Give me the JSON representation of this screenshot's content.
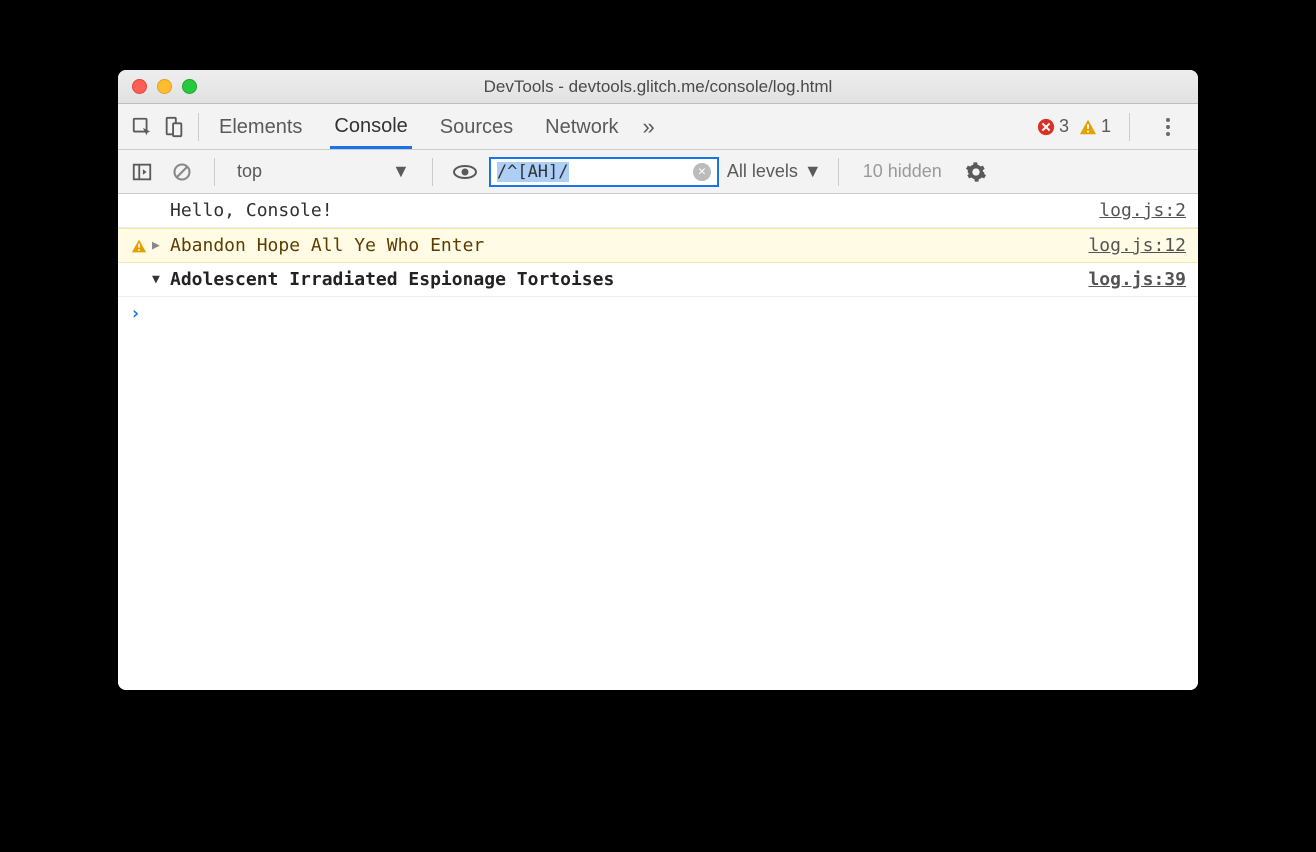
{
  "window": {
    "title": "DevTools - devtools.glitch.me/console/log.html"
  },
  "tabs": {
    "items": [
      "Elements",
      "Console",
      "Sources",
      "Network"
    ],
    "errors": "3",
    "warnings": "1"
  },
  "toolbar": {
    "context": "top",
    "filter_value": "/^[AH]/",
    "levels_label": "All levels",
    "hidden_label": "10 hidden"
  },
  "messages": [
    {
      "type": "log",
      "text": "Hello, Console!",
      "src": "log.js:2"
    },
    {
      "type": "warn",
      "text": "Abandon Hope All Ye Who Enter",
      "src": "log.js:12"
    },
    {
      "type": "group",
      "text": "Adolescent Irradiated Espionage Tortoises",
      "src": "log.js:39"
    }
  ]
}
